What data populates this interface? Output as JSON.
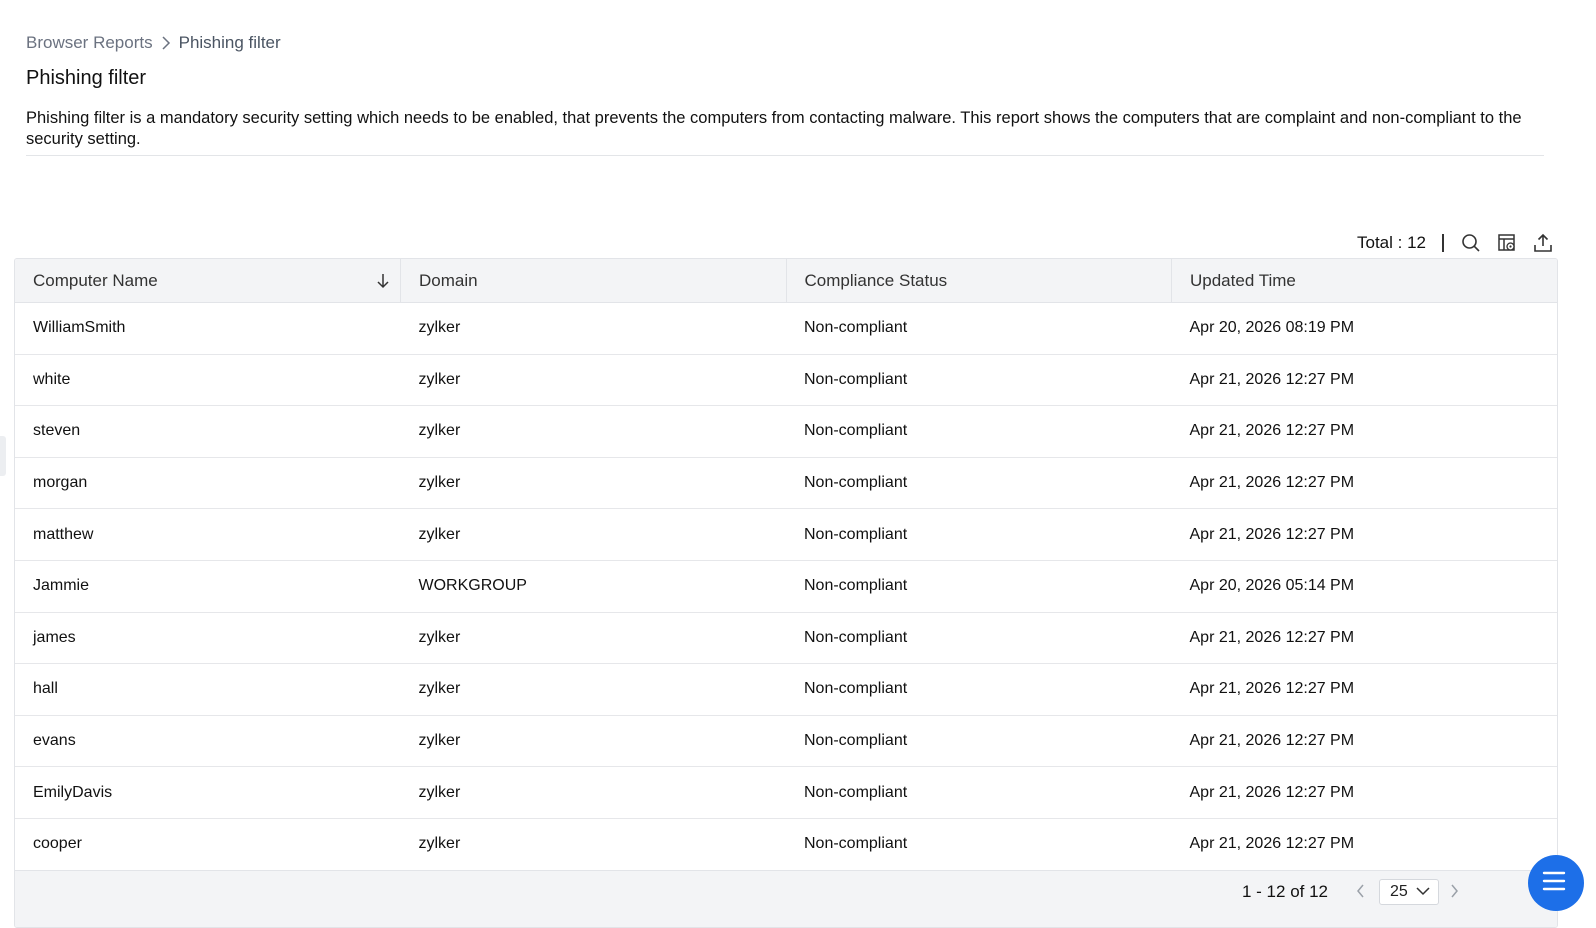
{
  "breadcrumb": {
    "parent": "Browser Reports",
    "current": "Phishing filter"
  },
  "page": {
    "title": "Phishing filter",
    "description": "Phishing filter is a mandatory security setting which needs to be enabled, that prevents the computers from contacting malware. This report shows the computers that are complaint and non-compliant to the security setting."
  },
  "toolbar": {
    "total": "Total : 12",
    "icons": [
      "search-icon",
      "column-settings-icon",
      "export-icon"
    ]
  },
  "table": {
    "columns": [
      "Computer Name",
      "Domain",
      "Compliance Status",
      "Updated Time"
    ],
    "sort": {
      "column": "Computer Name",
      "direction": "descending"
    },
    "rows": [
      [
        "WilliamSmith",
        "zylker",
        "Non-compliant",
        "Apr 20, 2026 08:19 PM"
      ],
      [
        "white",
        "zylker",
        "Non-compliant",
        "Apr 21, 2026 12:27 PM"
      ],
      [
        "steven",
        "zylker",
        "Non-compliant",
        "Apr 21, 2026 12:27 PM"
      ],
      [
        "morgan",
        "zylker",
        "Non-compliant",
        "Apr 21, 2026 12:27 PM"
      ],
      [
        "matthew",
        "zylker",
        "Non-compliant",
        "Apr 21, 2026 12:27 PM"
      ],
      [
        "Jammie",
        "WORKGROUP",
        "Non-compliant",
        "Apr 20, 2026 05:14 PM"
      ],
      [
        "james",
        "zylker",
        "Non-compliant",
        "Apr 21, 2026 12:27 PM"
      ],
      [
        "hall",
        "zylker",
        "Non-compliant",
        "Apr 21, 2026 12:27 PM"
      ],
      [
        "evans",
        "zylker",
        "Non-compliant",
        "Apr 21, 2026 12:27 PM"
      ],
      [
        "EmilyDavis",
        "zylker",
        "Non-compliant",
        "Apr 21, 2026 12:27 PM"
      ],
      [
        "cooper",
        "zylker",
        "Non-compliant",
        "Apr 21, 2026 12:27 PM"
      ]
    ]
  },
  "pagination": {
    "range": "1 - 12 of 12",
    "per_page": "25"
  },
  "colors": {
    "accent": "#1d6fe8",
    "header_bg": "#f3f4f6",
    "border": "#e2e4e8"
  }
}
